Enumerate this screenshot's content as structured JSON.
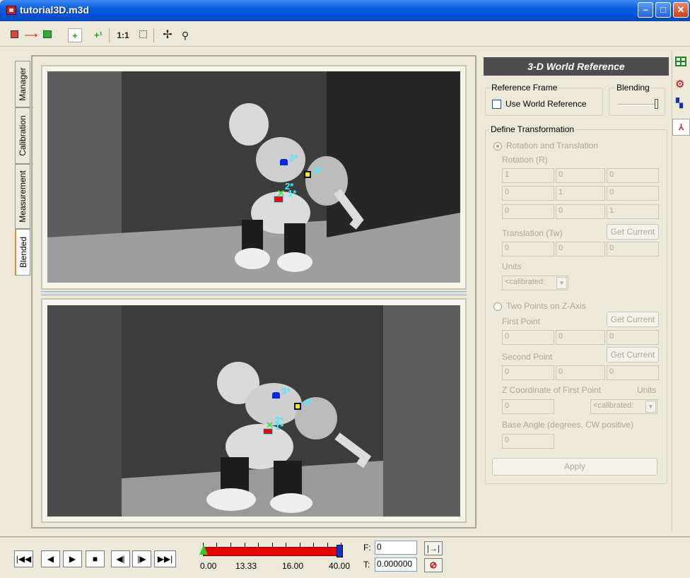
{
  "window": {
    "title": "tutorial3D.m3d"
  },
  "toolbar": {
    "zoom_label": "1:1"
  },
  "side_tabs": [
    "Manager",
    "Calibration",
    "Measurement",
    "Blended"
  ],
  "markers_top": {
    "m3": "3*",
    "m4": "4*",
    "m2": "2*",
    "m1": "1*"
  },
  "markers_bottom": {
    "m3": "3*",
    "m4": "4*",
    "m2": "2*",
    "m1": "1*"
  },
  "panel": {
    "title": "3-D World Reference",
    "reference_frame": {
      "label": "Reference Frame",
      "checkbox_label": "Use World Reference",
      "checked": false
    },
    "blending": {
      "label": "Blending"
    },
    "define": {
      "label": "Define Transformation",
      "option_rt": "Rotation and Translation",
      "rotation_label": "Rotation (R)",
      "rotation": [
        [
          "1",
          "0",
          "0"
        ],
        [
          "0",
          "1",
          "0"
        ],
        [
          "0",
          "0",
          "1"
        ]
      ],
      "translation_label": "Translation (Tw)",
      "translation": [
        "0",
        "0",
        "0"
      ],
      "get_current": "Get Current",
      "units_label": "Units",
      "units_value": "<calibrated:",
      "option_zaxis": "Two Points on Z-Axis",
      "first_point_label": "First Point",
      "first_point": [
        "0",
        "0",
        "0"
      ],
      "second_point_label": "Second Point",
      "second_point": [
        "0",
        "0",
        "0"
      ],
      "zcoord_label": "Z Coordinate of First Point",
      "zcoord_value": "0",
      "units2_label": "Units",
      "units2_value": "<calibrated:",
      "base_angle_label": "Base Angle (degrees, CW positive)",
      "base_angle_value": "0",
      "apply": "Apply"
    }
  },
  "timeline": {
    "ticks": [
      "0.00",
      "13.33",
      "16.00",
      "40.00"
    ],
    "frame_label": "F:",
    "frame_value": "0",
    "time_label": "T:",
    "time_value": "0.000000"
  }
}
